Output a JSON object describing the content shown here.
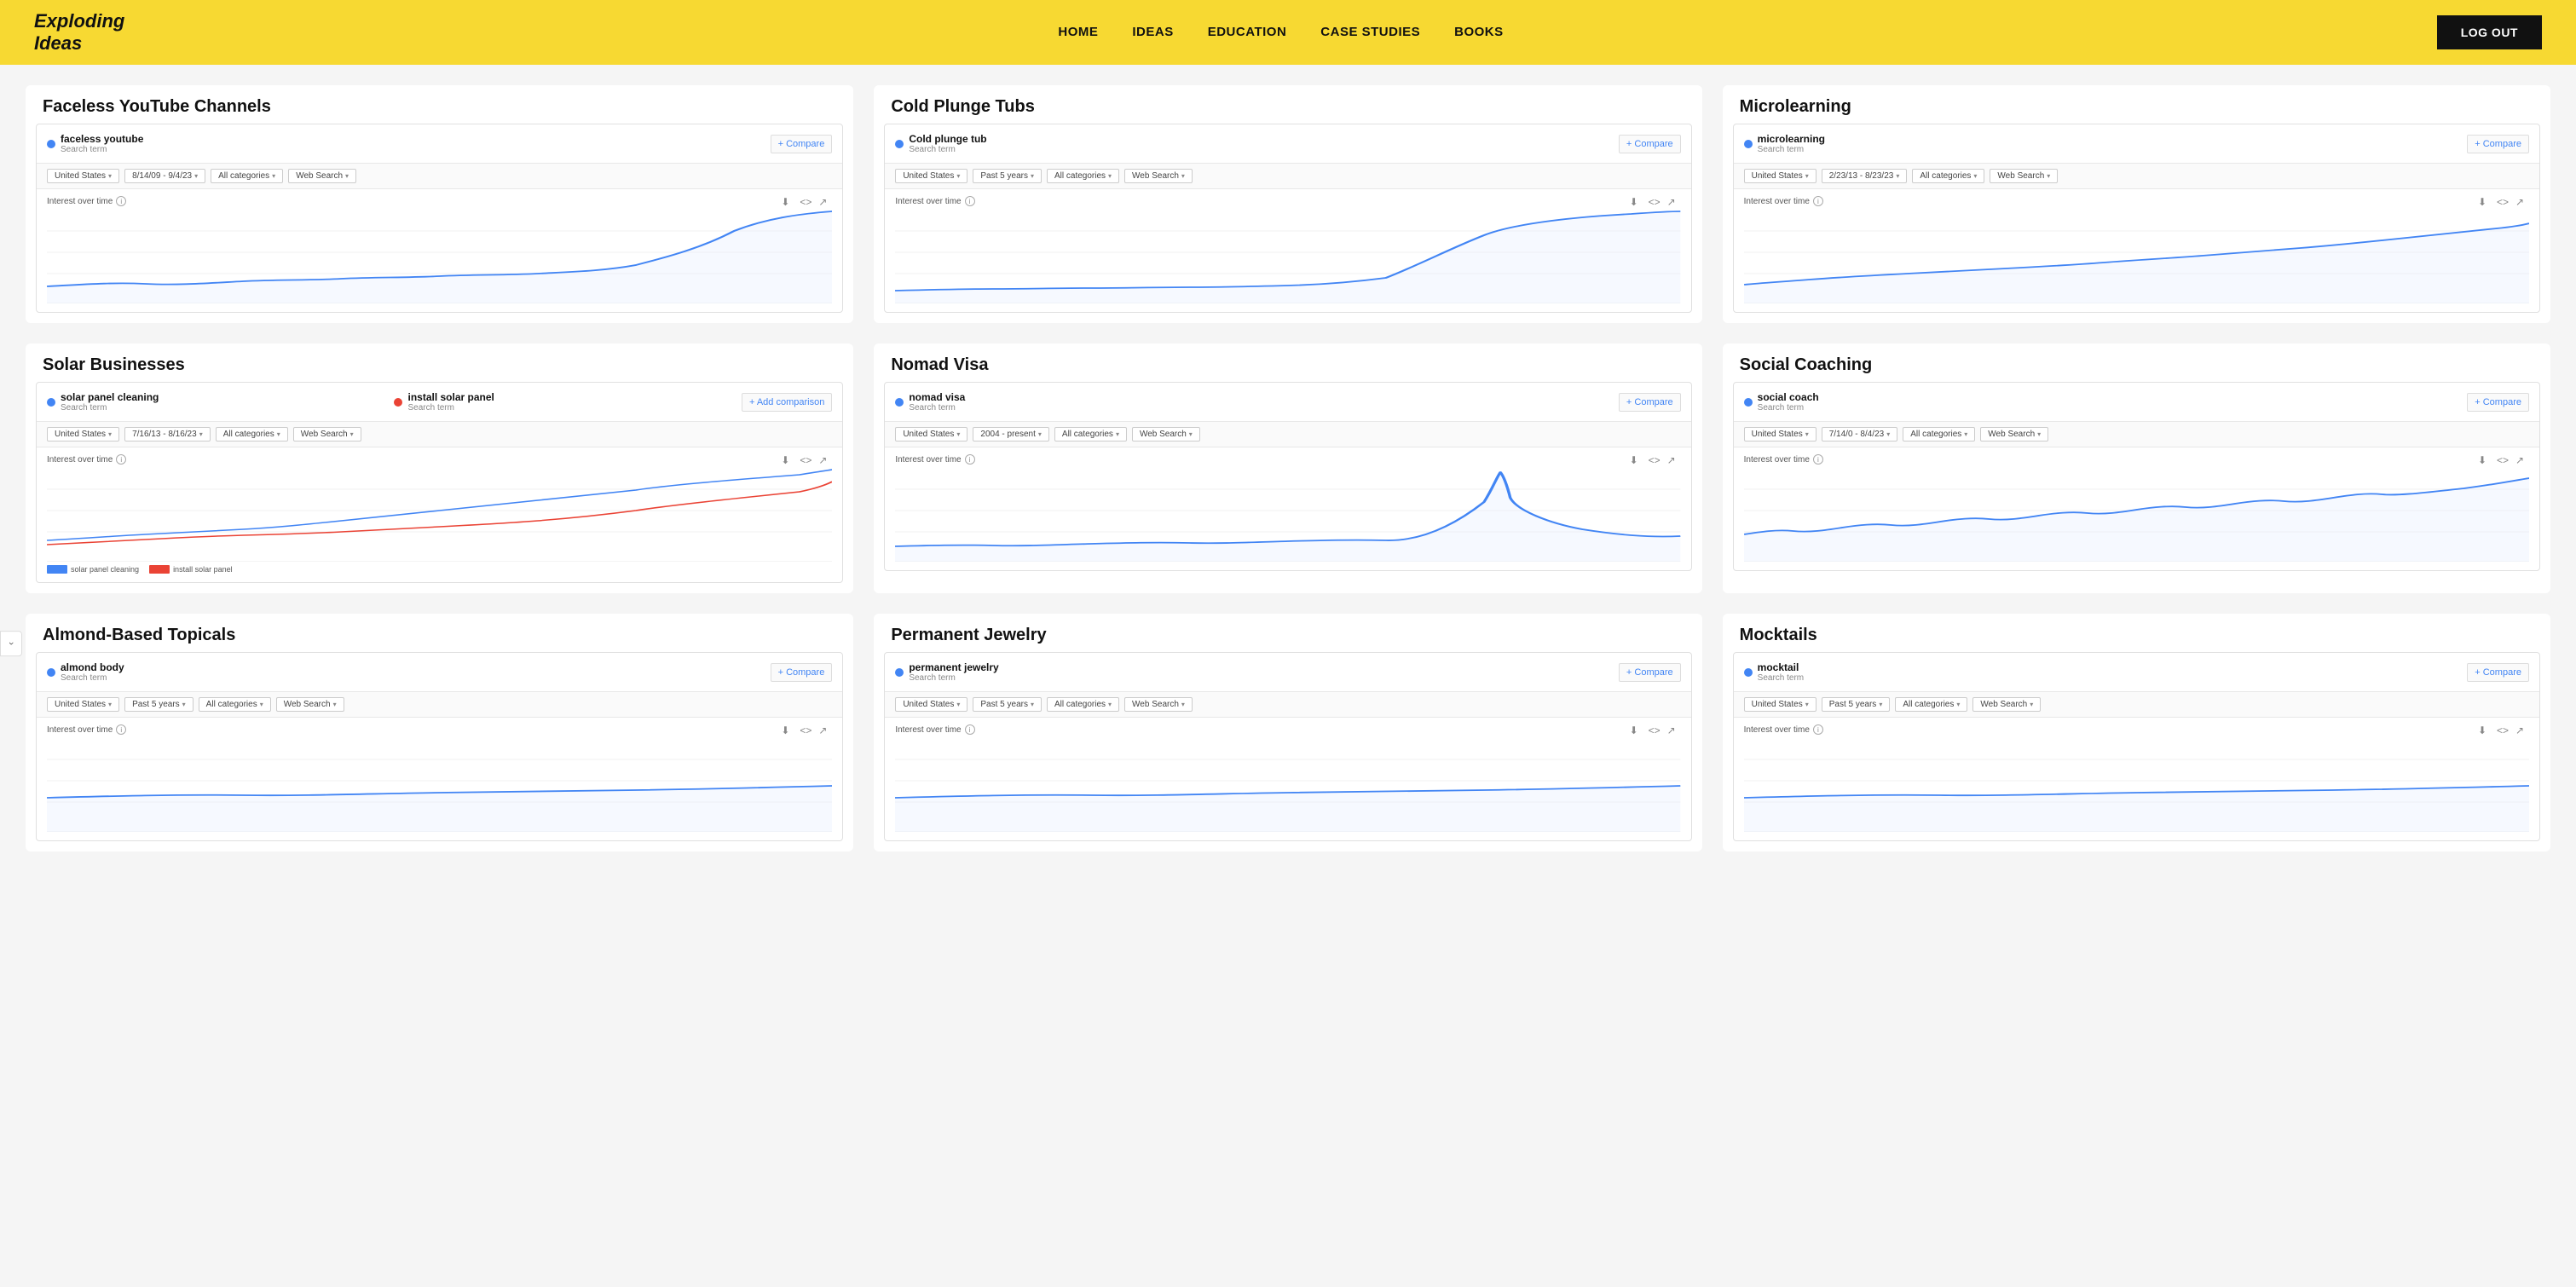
{
  "nav": {
    "logo_line1": "Exploding",
    "logo_line2": "Ideas",
    "links": [
      {
        "label": "HOME",
        "name": "home"
      },
      {
        "label": "IDEAS",
        "name": "ideas"
      },
      {
        "label": "EDUCATION",
        "name": "education"
      },
      {
        "label": "CASE STUDIES",
        "name": "case-studies"
      },
      {
        "label": "BOOKS",
        "name": "books"
      }
    ],
    "logout_label": "LOG OUT"
  },
  "cards": [
    {
      "id": "faceless-youtube",
      "title": "Faceless YouTube Channels",
      "term": "faceless youtube",
      "term_type": "Search term",
      "dot": "blue",
      "compare_label": "Compare",
      "filters": [
        "United States",
        "8/14/09 - 9/4/23",
        "All categories",
        "Web Search"
      ],
      "chart_label": "Interest over time",
      "chart_type": "uptrend_end",
      "has_second_term": false
    },
    {
      "id": "cold-plunge-tubs",
      "title": "Cold Plunge Tubs",
      "term": "Cold plunge tub",
      "term_type": "Search term",
      "dot": "blue",
      "compare_label": "Compare",
      "filters": [
        "United States",
        "Past 5 years",
        "All categories",
        "Web Search"
      ],
      "chart_label": "Interest over time",
      "chart_type": "hockey_stick",
      "has_second_term": false
    },
    {
      "id": "microlearning",
      "title": "Microlearning",
      "term": "microlearning",
      "term_type": "Search term",
      "dot": "blue",
      "compare_label": "Compare",
      "filters": [
        "United States",
        "2/23/13 - 8/23/23",
        "All categories",
        "Web Search"
      ],
      "chart_label": "Interest over time",
      "chart_type": "gradual_up",
      "has_second_term": false
    },
    {
      "id": "solar-businesses",
      "title": "Solar Businesses",
      "term": "solar panel cleaning",
      "term_type": "Search term",
      "term2": "install solar panel",
      "term_type2": "Search term",
      "dot": "blue",
      "dot2": "red",
      "add_comparison_label": "Add comparison",
      "filters": [
        "United States",
        "7/16/13 - 8/16/23",
        "All categories",
        "Web Search"
      ],
      "chart_label": "Interest over time",
      "chart_type": "dual_uptrend",
      "has_second_term": true
    },
    {
      "id": "nomad-visa",
      "title": "Nomad Visa",
      "term": "nomad visa",
      "term_type": "Search term",
      "dot": "blue",
      "compare_label": "Compare",
      "filters": [
        "United States",
        "2004 - present",
        "All categories",
        "Web Search"
      ],
      "chart_label": "Interest over time",
      "chart_type": "spike_recent",
      "has_second_term": false
    },
    {
      "id": "social-coaching",
      "title": "Social Coaching",
      "term": "social coach",
      "term_type": "Search term",
      "dot": "blue",
      "compare_label": "Compare",
      "filters": [
        "United States",
        "7/14/0 - 8/4/23",
        "All categories",
        "Web Search"
      ],
      "chart_label": "Interest over time",
      "chart_type": "wavy_up",
      "has_second_term": false
    },
    {
      "id": "almond-based-topicals",
      "title": "Almond-Based Topicals",
      "term": "almond body",
      "term_type": "Search term",
      "dot": "blue",
      "compare_label": "Compare",
      "filters": [
        "United States",
        "Past 5 years",
        "All categories",
        "Web Search"
      ],
      "chart_label": "Interest over time",
      "chart_type": "flat",
      "has_second_term": false
    },
    {
      "id": "permanent-jewelry",
      "title": "Permanent Jewelry",
      "term": "permanent jewelry",
      "term_type": "Search term",
      "dot": "blue",
      "compare_label": "Compare",
      "filters": [
        "United States",
        "Past 5 years",
        "All categories",
        "Web Search"
      ],
      "chart_label": "Interest over time",
      "chart_type": "flat",
      "has_second_term": false
    },
    {
      "id": "mocktails",
      "title": "Mocktails",
      "term": "mocktail",
      "term_type": "Search term",
      "dot": "blue",
      "compare_label": "Compare",
      "filters": [
        "United States",
        "Past 5 years",
        "All categories",
        "Web Search"
      ],
      "chart_label": "Interest over time",
      "chart_type": "flat",
      "has_second_term": false
    }
  ],
  "colors": {
    "accent": "#f7d932",
    "blue_dot": "#4285f4",
    "red_dot": "#ea4335",
    "chart_blue": "#4285f4",
    "chart_red": "#ea4335"
  },
  "side_arrow": "m"
}
